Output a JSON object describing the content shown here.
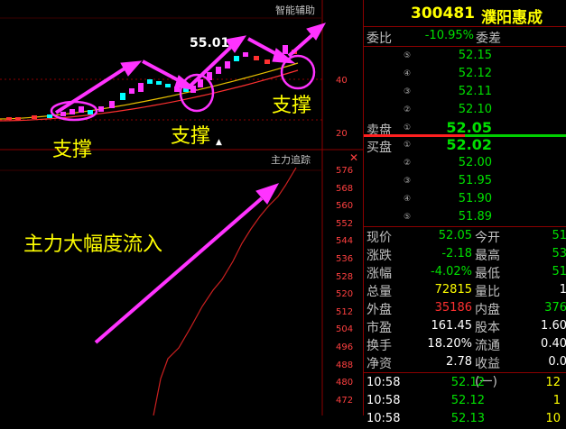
{
  "stock": {
    "code": "300481",
    "name": "濮阳惠成"
  },
  "panels": {
    "upper_label": "智能辅助",
    "lower_label": "主力追踪",
    "close_x": "✕"
  },
  "main_chart": {
    "price_label": "55.01",
    "right_axis": [
      "40",
      "20"
    ],
    "annotations": {
      "support1": "支撑",
      "support2": "支撑",
      "support3": "支撑",
      "inflow": "主力大幅度流入"
    },
    "cursor_marker": "▲"
  },
  "lower_chart": {
    "y_ticks": [
      "576",
      "568",
      "560",
      "552",
      "544",
      "536",
      "528",
      "520",
      "512",
      "504",
      "496",
      "488",
      "480",
      "472"
    ]
  },
  "order_book": {
    "weibi_label": "委比",
    "weibi_value": "-10.95%",
    "weicha_label": "委差",
    "sell": [
      {
        "idx": "⑤",
        "price": "52.15"
      },
      {
        "idx": "④",
        "price": "52.12"
      },
      {
        "idx": "③",
        "price": "52.11"
      },
      {
        "idx": "②",
        "price": "52.10"
      },
      {
        "idx": "①",
        "price": "52.05",
        "label": "卖盘"
      }
    ],
    "buy": [
      {
        "idx": "①",
        "price": "52.02",
        "label": "买盘"
      },
      {
        "idx": "②",
        "price": "52.00"
      },
      {
        "idx": "③",
        "price": "51.95"
      },
      {
        "idx": "④",
        "price": "51.90"
      },
      {
        "idx": "⑤",
        "price": "51.89"
      }
    ]
  },
  "quote": [
    {
      "l1": "现价",
      "v1": "52.05",
      "c1": "green",
      "l2": "今开",
      "v2": "51",
      "c2": "green"
    },
    {
      "l1": "涨跌",
      "v1": "-2.18",
      "c1": "green",
      "l2": "最高",
      "v2": "53",
      "c2": "green"
    },
    {
      "l1": "涨幅",
      "v1": "-4.02%",
      "c1": "green",
      "l2": "最低",
      "v2": "51",
      "c2": "green"
    },
    {
      "l1": "总量",
      "v1": "72815",
      "c1": "yellow",
      "l2": "量比",
      "v2": "1",
      "c2": "white"
    },
    {
      "l1": "外盘",
      "v1": "35186",
      "c1": "red",
      "l2": "内盘",
      "v2": "376",
      "c2": "green"
    },
    {
      "l1": "市盈",
      "v1": "161.45",
      "c1": "white",
      "l2": "股本",
      "v2": "1.60",
      "c2": "white"
    },
    {
      "l1": "换手",
      "v1": "18.20%",
      "c1": "white",
      "l2": "流通",
      "v2": "0.40",
      "c2": "white"
    },
    {
      "l1": "净资",
      "v1": "2.78",
      "c1": "white",
      "l2": "收益(一)",
      "v2": "0.0",
      "c2": "white"
    }
  ],
  "ticks": [
    {
      "time": "10:58",
      "price": "52.12",
      "vol": "12"
    },
    {
      "time": "10:58",
      "price": "52.12",
      "vol": "1"
    },
    {
      "time": "10:58",
      "price": "52.13",
      "vol": "10"
    }
  ],
  "colors": {
    "magenta": "#ff33ff",
    "red": "#ff3030",
    "green": "#00e000",
    "yellow": "#ffff00",
    "border": "#8b0000"
  }
}
